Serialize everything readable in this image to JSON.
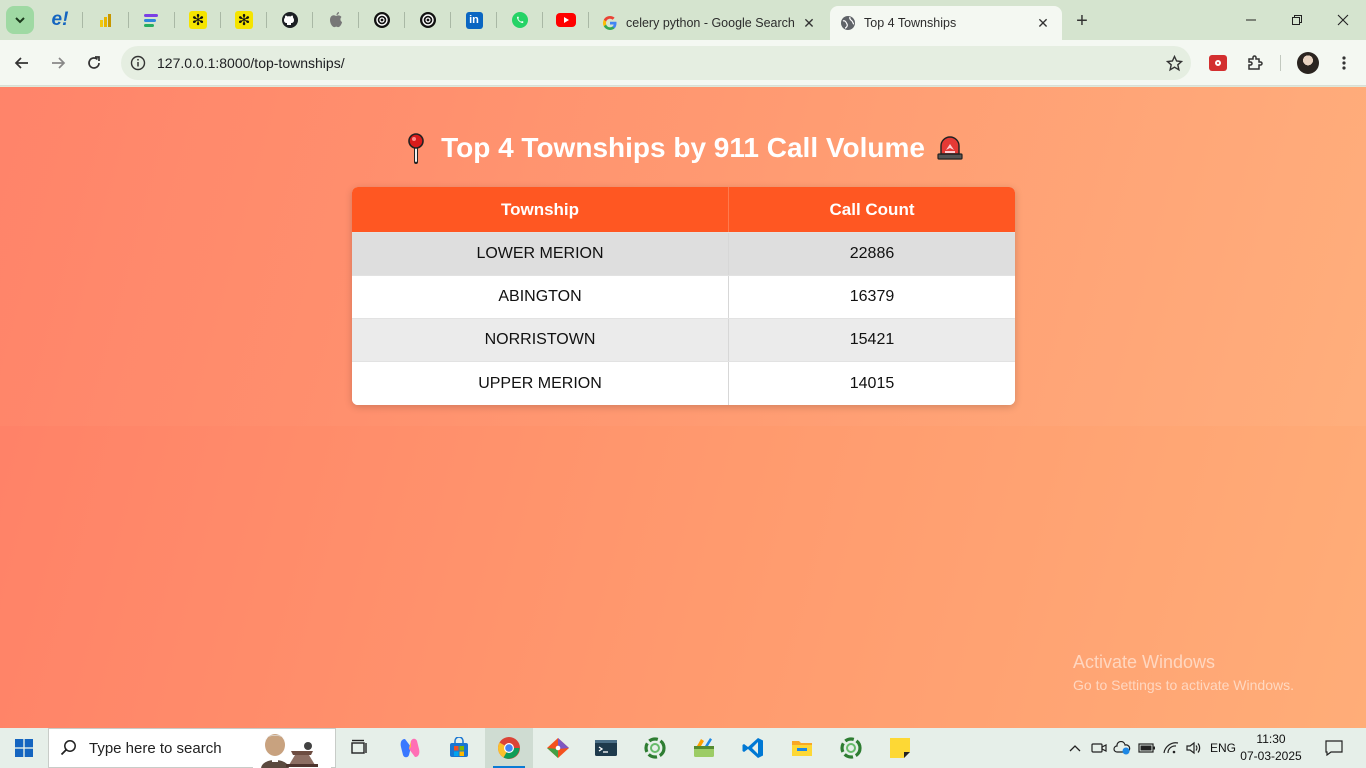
{
  "browser": {
    "tabs": [
      {
        "title": "celery python - Google Search",
        "active": false
      },
      {
        "title": "Top 4 Townships",
        "active": true
      }
    ],
    "pinned_icons": [
      "emagister-icon",
      "power-bi-icon",
      "stack-icon",
      "asterisk-icon",
      "asterisk-icon",
      "github-icon",
      "apple-icon",
      "openai-icon",
      "openai-icon",
      "linkedin-icon",
      "whatsapp-icon",
      "youtube-icon"
    ],
    "address": "127.0.0.1:8000/top-townships/"
  },
  "page": {
    "title": "Top 4 Townships by 911 Call Volume",
    "table": {
      "headers": [
        "Township",
        "Call Count"
      ],
      "rows": [
        {
          "township": "LOWER MERION",
          "count": "22886"
        },
        {
          "township": "ABINGTON",
          "count": "16379"
        },
        {
          "township": "NORRISTOWN",
          "count": "15421"
        },
        {
          "township": "UPPER MERION",
          "count": "14015"
        }
      ]
    },
    "watermark": {
      "line1": "Activate Windows",
      "line2": "Go to Settings to activate Windows."
    }
  },
  "taskbar": {
    "search_placeholder": "Type here to search",
    "language": "ENG",
    "time": "11:30",
    "date": "07-03-2025"
  },
  "colors": {
    "header_bg": "#ff5722",
    "page_gradient_start": "#ff7f67",
    "page_gradient_end": "#ffad78"
  }
}
